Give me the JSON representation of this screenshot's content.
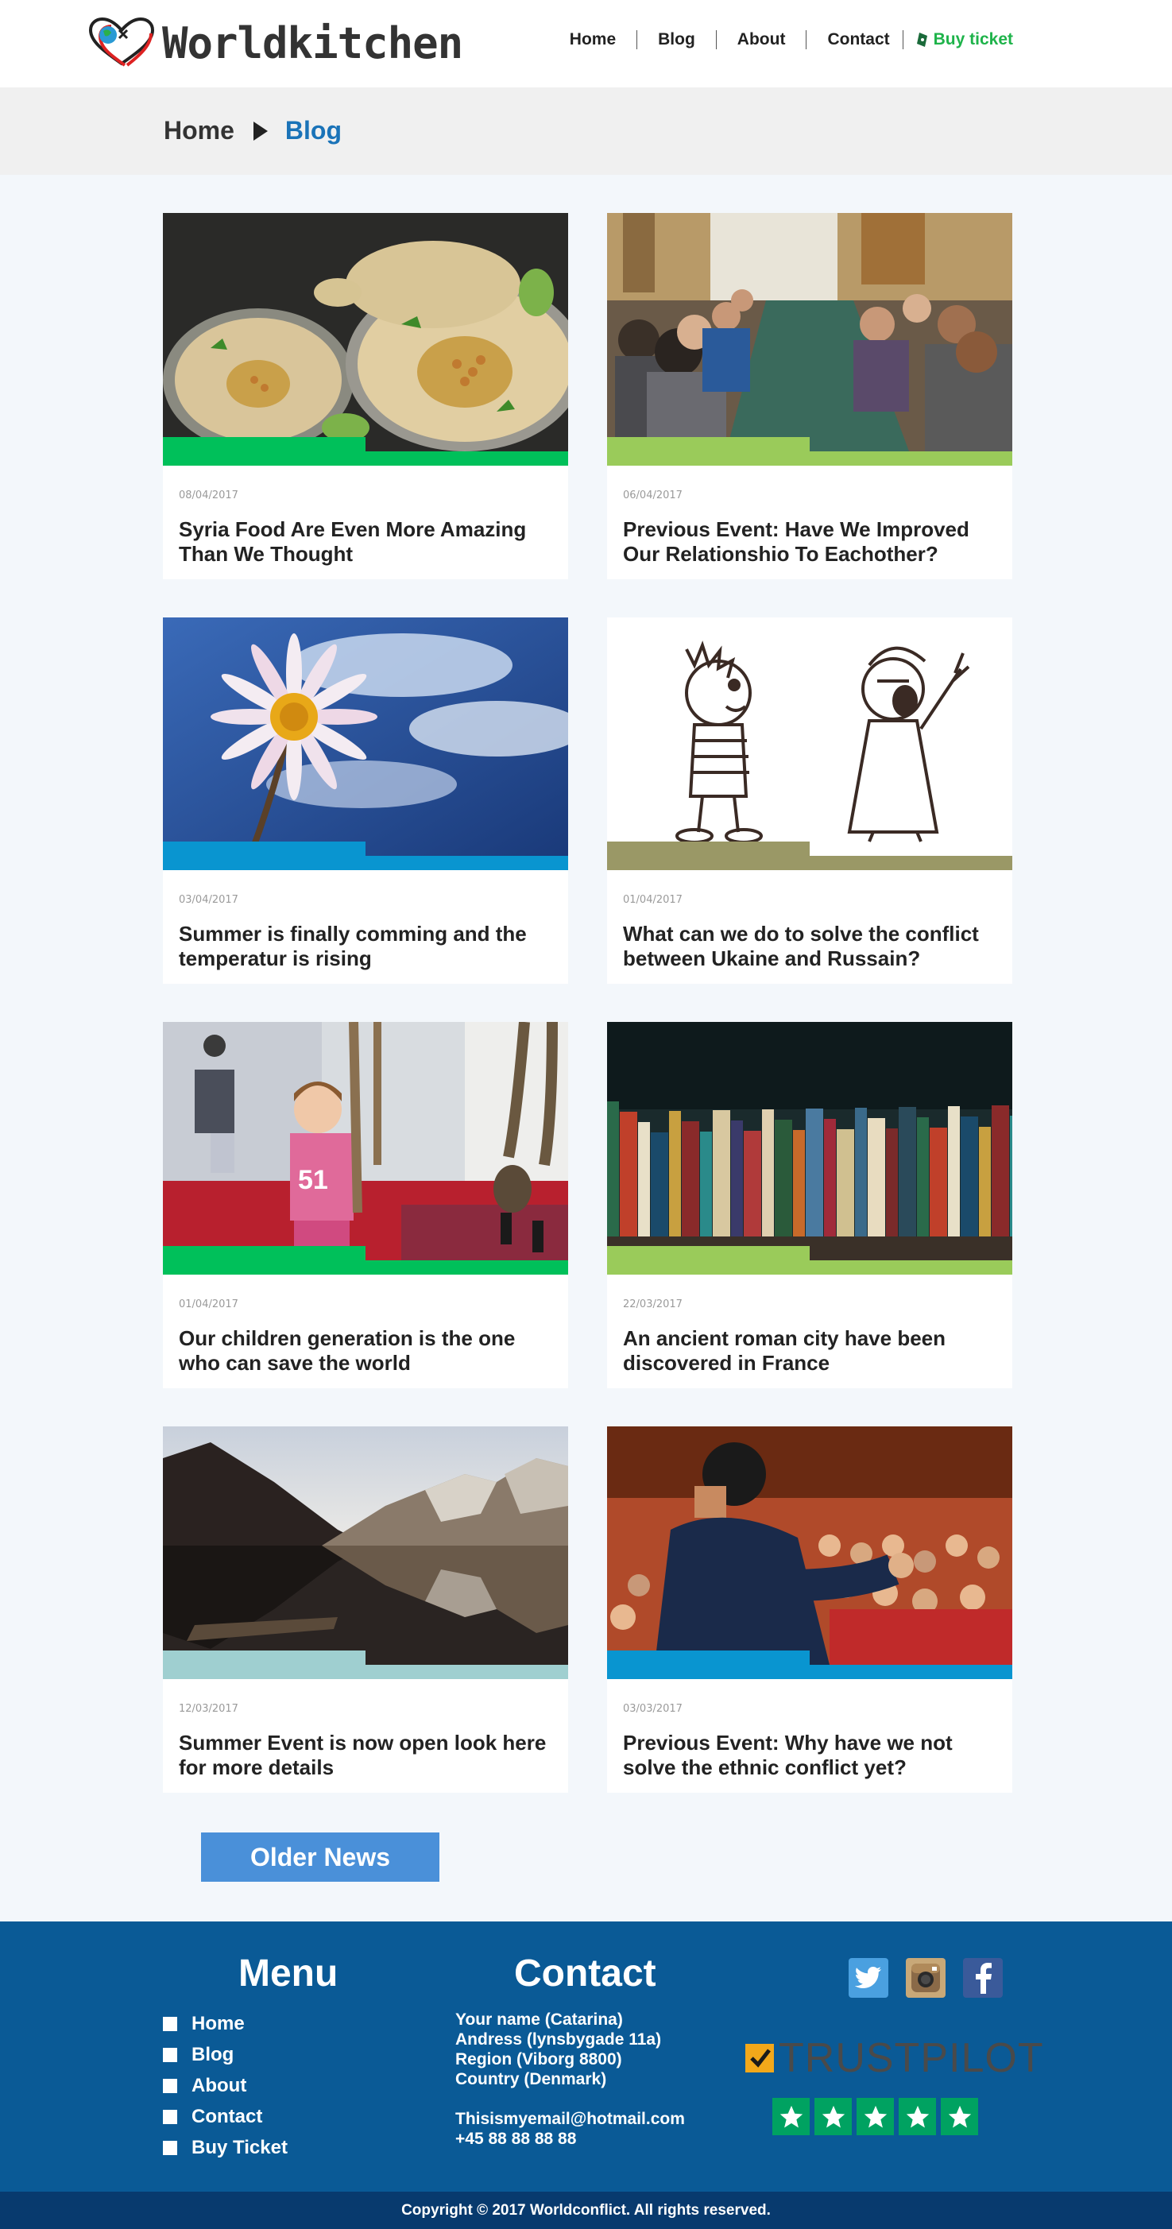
{
  "header": {
    "logo_text": "Worldkitchen",
    "nav": [
      "Home",
      "Blog",
      "About",
      "Contact"
    ],
    "buy_label": "Buy ticket"
  },
  "breadcrumb": {
    "home": "Home",
    "current": "Blog"
  },
  "posts": [
    {
      "date": "08/04/2017",
      "title": "Syria Food Are Even More Amazing Than We Thought",
      "bar_color": "#00c05a",
      "image": "hummus"
    },
    {
      "date": "06/04/2017",
      "title": "Previous Event: Have We Improved Our Relationshio To Eachother?",
      "bar_color": "#9acb5a",
      "image": "conference-table"
    },
    {
      "date": "03/04/2017",
      "title": "Summer is finally comming and the temperatur is rising",
      "bar_color": "#0995d0",
      "image": "daisy"
    },
    {
      "date": "01/04/2017",
      "title": "What can we do to solve the conflict between Ukaine and Russain?",
      "bar_color": "#9a9866",
      "image": "cartoon"
    },
    {
      "date": "01/04/2017",
      "title": "Our children generation is the one who can save the world",
      "bar_color": "#00c05a",
      "image": "child-ropes"
    },
    {
      "date": "22/03/2017",
      "title": "An ancient roman city have been discovered in France",
      "bar_color": "#9acb5a",
      "image": "books"
    },
    {
      "date": "12/03/2017",
      "title": "Summer Event is now open look here for more details",
      "bar_color": "#9fcfd0",
      "image": "mountain-lake"
    },
    {
      "date": "03/03/2017",
      "title": "Previous Event: Why have we not solve the ethnic conflict yet?",
      "bar_color": "#0995d0",
      "image": "speaker"
    }
  ],
  "older_news_label": "Older News",
  "footer": {
    "menu_heading": "Menu",
    "menu_items": [
      "Home",
      "Blog",
      "About",
      "Contact",
      "Buy Ticket"
    ],
    "contact_heading": "Contact",
    "contact_lines": [
      "Your name (Catarina)",
      "Andress (lynsbygade 11a)",
      "Region (Viborg 8800)",
      "Country (Denmark)"
    ],
    "email": "Thisismyemail@hotmail.com",
    "phone": "+45 88 88 88 88",
    "social": [
      "twitter-icon",
      "instagram-icon",
      "facebook-icon"
    ],
    "trustpilot_trust": "TRUST",
    "trustpilot_pilot": "PILOT",
    "copyright": "Copyright © 2017 Worldconflict.  All rights reserved."
  },
  "colors": {
    "footer_bg": "#0a5a96",
    "copyright_bg": "#083a6e",
    "accent_blue": "#1a73b8",
    "buy_green": "#1eb34a",
    "button_blue": "#4a90d9"
  }
}
